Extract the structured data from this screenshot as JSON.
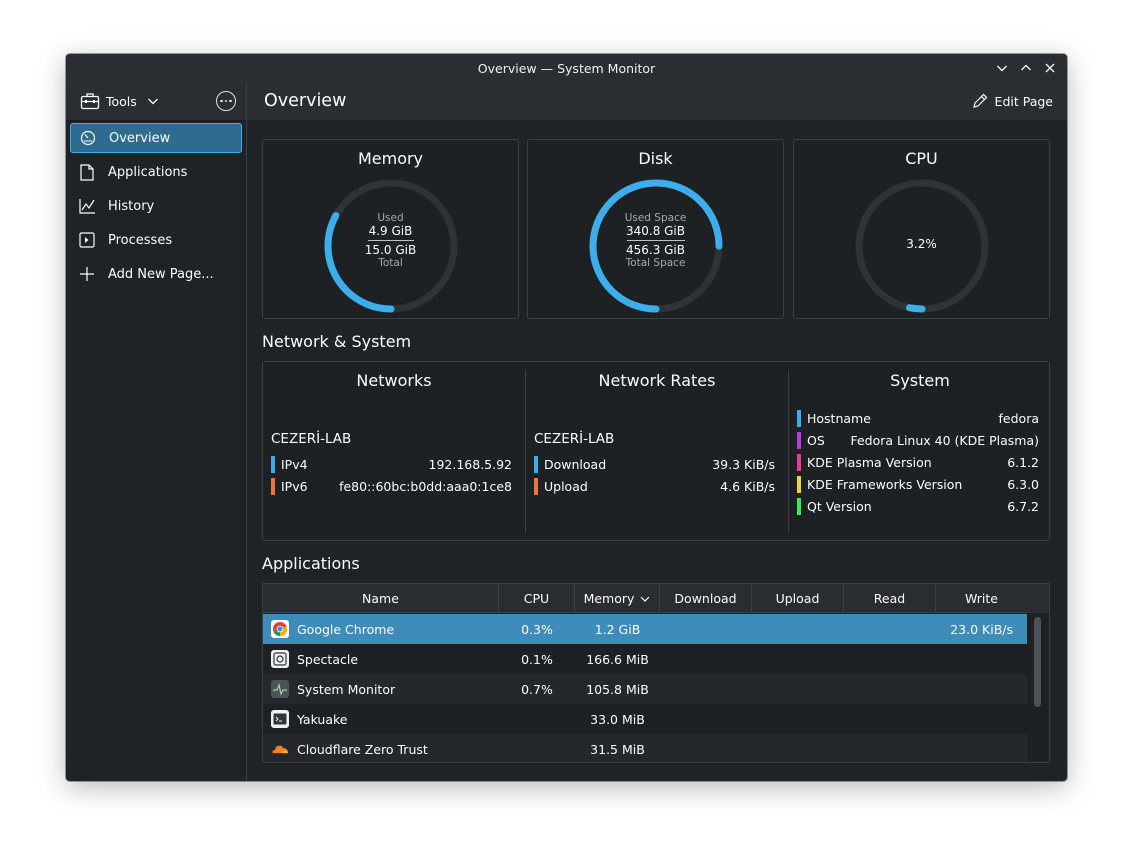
{
  "window": {
    "title": "Overview — System Monitor"
  },
  "sidebar": {
    "tools_label": "Tools",
    "items": [
      {
        "label": "Overview",
        "icon": "speedometer-icon",
        "active": true
      },
      {
        "label": "Applications",
        "icon": "document-icon"
      },
      {
        "label": "History",
        "icon": "chart-line-icon"
      },
      {
        "label": "Processes",
        "icon": "terminal-window-icon"
      },
      {
        "label": "Add New Page...",
        "icon": "plus-icon"
      }
    ]
  },
  "header": {
    "title": "Overview",
    "edit_label": "Edit Page"
  },
  "gauges": {
    "memory": {
      "title": "Memory",
      "top_label": "Used",
      "used": "4.9 GiB",
      "total": "15.0 GiB",
      "bottom_label": "Total",
      "fraction": 0.33
    },
    "disk": {
      "title": "Disk",
      "top_label": "Used Space",
      "used": "340.8 GiB",
      "total": "456.3 GiB",
      "bottom_label": "Total Space",
      "fraction": 0.75
    },
    "cpu": {
      "title": "CPU",
      "value": "3.2%",
      "fraction": 0.032
    }
  },
  "network_section": {
    "title": "Network & System",
    "networks": {
      "title": "Networks",
      "name": "CEZERİ-LAB",
      "rows": [
        {
          "key": "IPv4",
          "value": "192.168.5.92",
          "color": "#3daee9"
        },
        {
          "key": "IPv6",
          "value": "fe80::60bc:b0dd:aaa0:1ce8",
          "color": "#e9763d"
        }
      ]
    },
    "rates": {
      "title": "Network Rates",
      "name": "CEZERİ-LAB",
      "rows": [
        {
          "key": "Download",
          "value": "39.3 KiB/s",
          "color": "#3daee9"
        },
        {
          "key": "Upload",
          "value": "4.6 KiB/s",
          "color": "#e9763d"
        }
      ]
    },
    "system": {
      "title": "System",
      "rows": [
        {
          "key": "Hostname",
          "value": "fedora",
          "color": "#3daee9"
        },
        {
          "key": "OS",
          "value": "Fedora Linux 40 (KDE Plasma)",
          "color": "#b93dd9"
        },
        {
          "key": "KDE Plasma Version",
          "value": "6.1.2",
          "color": "#e93d8c"
        },
        {
          "key": "KDE Frameworks Version",
          "value": "6.3.0",
          "color": "#e9d83d"
        },
        {
          "key": "Qt Version",
          "value": "6.7.2",
          "color": "#3de95a"
        }
      ]
    }
  },
  "applications": {
    "title": "Applications",
    "columns": [
      "Name",
      "CPU",
      "Memory",
      "Download",
      "Upload",
      "Read",
      "Write"
    ],
    "rows": [
      {
        "name": "Google Chrome",
        "icon": "chrome-icon",
        "cpu": "0.3%",
        "memory": "1.2 GiB",
        "download": "",
        "upload": "",
        "read": "",
        "write": "23.0 KiB/s"
      },
      {
        "name": "Spectacle",
        "icon": "spectacle-icon",
        "cpu": "0.1%",
        "memory": "166.6 MiB",
        "download": "",
        "upload": "",
        "read": "",
        "write": ""
      },
      {
        "name": "System Monitor",
        "icon": "system-monitor-icon",
        "cpu": "0.7%",
        "memory": "105.8 MiB",
        "download": "",
        "upload": "",
        "read": "",
        "write": ""
      },
      {
        "name": "Yakuake",
        "icon": "terminal-icon",
        "cpu": "",
        "memory": "33.0 MiB",
        "download": "",
        "upload": "",
        "read": "",
        "write": ""
      },
      {
        "name": "Cloudflare Zero Trust",
        "icon": "cloudflare-icon",
        "cpu": "",
        "memory": "31.5 MiB",
        "download": "",
        "upload": "",
        "read": "",
        "write": ""
      }
    ]
  },
  "colors": {
    "accent": "#3daee9",
    "background": "#202326",
    "card": "#1e2124",
    "selection": "#3d8cb9"
  }
}
